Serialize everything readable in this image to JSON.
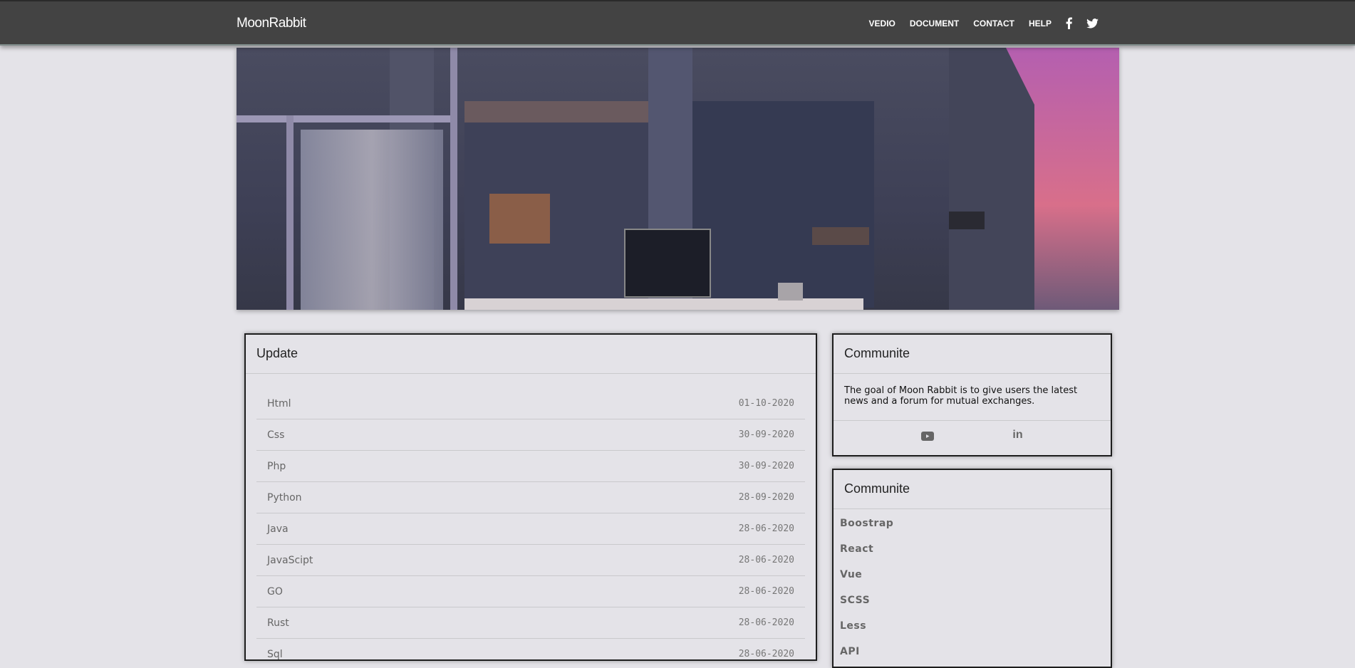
{
  "nav": {
    "brand": "MoonRabbit",
    "links": [
      "VEDIO",
      "DOCUMENT",
      "CONTACT",
      "HELP"
    ],
    "social": [
      "facebook-icon",
      "twitter-icon"
    ]
  },
  "update": {
    "title": "Update",
    "rows": [
      {
        "name": "Html",
        "date": "01-10-2020"
      },
      {
        "name": "Css",
        "date": "30-09-2020"
      },
      {
        "name": "Php",
        "date": "30-09-2020"
      },
      {
        "name": "Python",
        "date": "28-09-2020"
      },
      {
        "name": "Java",
        "date": "28-06-2020"
      },
      {
        "name": "JavaScipt",
        "date": "28-06-2020"
      },
      {
        "name": "GO",
        "date": "28-06-2020"
      },
      {
        "name": "Rust",
        "date": "28-06-2020"
      },
      {
        "name": "Sql",
        "date": "28-06-2020"
      }
    ]
  },
  "community": {
    "title": "Communite",
    "description": "The goal of Moon Rabbit is to give users the latest news and a forum for mutual exchanges.",
    "icons": [
      "youtube-icon",
      "linkedin-icon"
    ]
  },
  "community2": {
    "title": "Communite",
    "items": [
      "Boostrap",
      "React",
      "Vue",
      "SCSS",
      "Less",
      "API"
    ]
  }
}
